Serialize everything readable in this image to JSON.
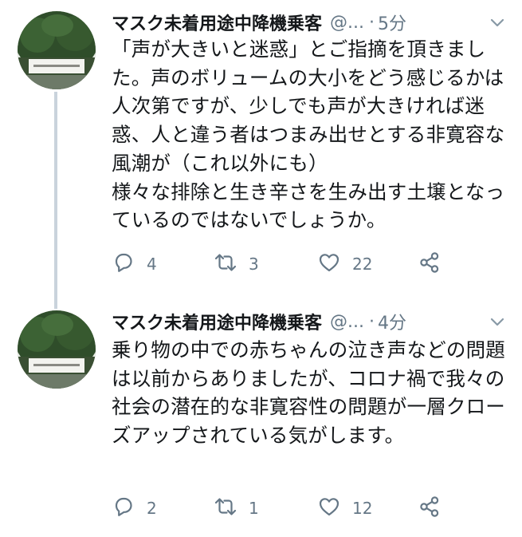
{
  "tweets": [
    {
      "name": "マスク未着用途中降機乗客",
      "handle": "@...",
      "separator": "·",
      "time": "5分",
      "text": "「声が大きいと迷惑」とご指摘を頂きました。声のボリュームの大小をどう感じるかは人次第ですが、少しでも声が大きければ迷惑、人と違う者はつまみ出せとする非寛容な風潮が（これ以外にも）\n様々な排除と生き辛さを生み出す土壌となっているのではないでしょうか。",
      "replies": "4",
      "retweets": "3",
      "likes": "22"
    },
    {
      "name": "マスク未着用途中降機乗客",
      "handle": "@...",
      "separator": "·",
      "time": "4分",
      "text": "乗り物の中での赤ちゃんの泣き声などの問題は以前からありましたが、コロナ禍で我々の社会の潜在的な非寛容性の問題が一層クローズアップされている気がします。",
      "replies": "2",
      "retweets": "1",
      "likes": "12"
    }
  ],
  "colors": {
    "text": "#14171a",
    "secondary": "#657786",
    "thread_line": "#c9d3dc"
  },
  "icons": {
    "reply": "reply-icon",
    "retweet": "retweet-icon",
    "like": "heart-icon",
    "share": "share-icon",
    "caret": "chevron-down-icon"
  }
}
